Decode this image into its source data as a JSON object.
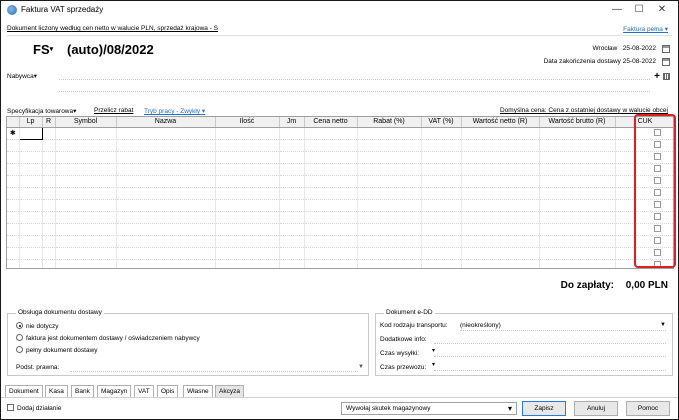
{
  "window": {
    "title": "Faktura VAT sprzedaży",
    "controls": {
      "minimize": "—",
      "maximize": "☐",
      "close": "✕"
    }
  },
  "doc_info_link": "Dokument liczony według cen netto w walucie PLN, sprzedaż krajowa - S",
  "faktura_pelna": "Faktura pełna",
  "header": {
    "series": "FS",
    "number": "(auto)/08/2022",
    "place": "Wrocław",
    "date": "25-08-2022",
    "end_label": "Data zakończenia dostawy",
    "end_date": "25-08-2022",
    "nabywca_label": "Nabywca"
  },
  "toolbar": {
    "spec": "Specyfikacja towarowa",
    "przelicz": "Przelicz rabat",
    "tryb": "Tryb pracy - Zwykły",
    "domyslna": "Domyślna cena: Cena z ostatniej dostawy w walucie obcej"
  },
  "grid": {
    "columns": [
      "",
      "Lp",
      "R",
      "Symbol",
      "Nazwa",
      "Ilość",
      "Jm",
      "Cena netto",
      "Rabat (%)",
      "VAT (%)",
      "Wartość netto (R)",
      "Wartość brutto (R)",
      "CUK"
    ],
    "new_row_marker": "✱",
    "checkbox_rows": 12
  },
  "totals": {
    "label": "Do zapłaty:",
    "value": "0,00 PLN"
  },
  "delivery": {
    "legend": "Obsługa dokumentu dostawy",
    "options": [
      {
        "label": "nie dotyczy",
        "selected": true
      },
      {
        "label": "faktura jest dokumentem dostawy / oświadczeniem nabywcy",
        "selected": false
      },
      {
        "label": "pełny dokument dostawy",
        "selected": false
      }
    ],
    "podst_label": "Podst. prawna:"
  },
  "edd": {
    "legend": "Dokument e-DD",
    "kod_label": "Kod rodzaju transportu:",
    "kod_value": "(nieokreślony)",
    "info_label": "Dodatkowe info:",
    "wysylka_label": "Czas wysyłki:",
    "przewozu_label": "Czas przewozu:"
  },
  "tabs": [
    "Dokument",
    "Kasa",
    "Bank",
    "Magazyn",
    "VAT",
    "Opis",
    "Własne",
    "Akcyza"
  ],
  "bottom": {
    "dodaj": "Dodaj działanie",
    "skutek": "Wywołaj skutek magazynowy",
    "zapisz": "Zapisz",
    "anuluj": "Anuluj",
    "pomoc": "Pomoc"
  },
  "colors": {
    "accent": "#1e6fd0",
    "highlight": "#e02020"
  }
}
